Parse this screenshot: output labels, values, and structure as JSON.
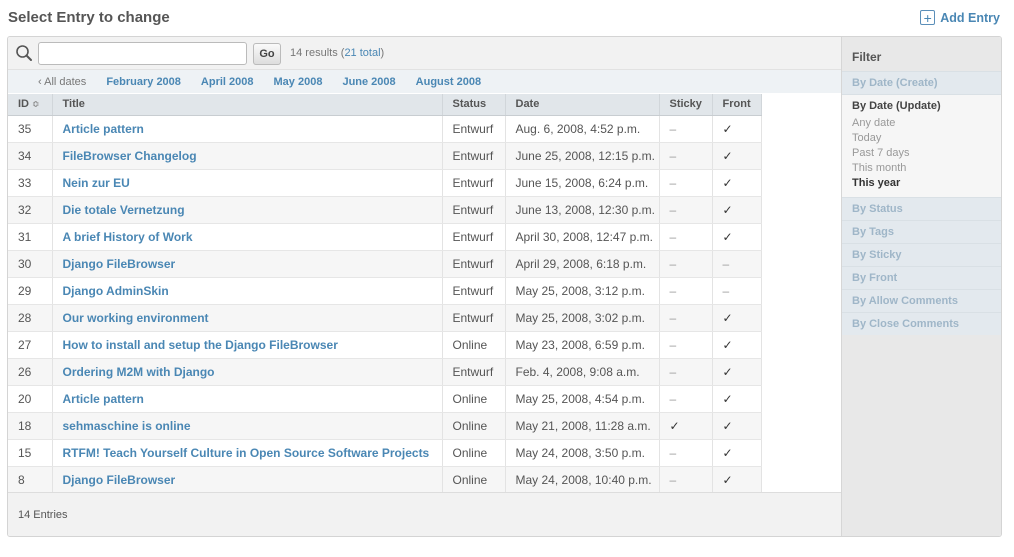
{
  "page": {
    "title": "Select Entry to change",
    "add_label": "Add Entry"
  },
  "search": {
    "value": "",
    "placeholder": "",
    "go_label": "Go",
    "results_count": "14 results",
    "results_total": "21 total"
  },
  "date_hierarchy": {
    "all_label": "‹ All dates",
    "dates": [
      "February 2008",
      "April 2008",
      "May 2008",
      "June 2008",
      "August 2008"
    ]
  },
  "table": {
    "headers": [
      "ID",
      "Title",
      "Status",
      "Date",
      "Sticky",
      "Front"
    ],
    "sort_indicator": "≎",
    "rows": [
      {
        "id": "35",
        "title": "Article pattern",
        "status": "Entwurf",
        "date": "Aug. 6, 2008, 4:52 p.m.",
        "sticky": "–",
        "front": "✓"
      },
      {
        "id": "34",
        "title": "FileBrowser Changelog",
        "status": "Entwurf",
        "date": "June 25, 2008, 12:15 p.m.",
        "sticky": "–",
        "front": "✓"
      },
      {
        "id": "33",
        "title": "Nein zur EU",
        "status": "Entwurf",
        "date": "June 15, 2008, 6:24 p.m.",
        "sticky": "–",
        "front": "✓"
      },
      {
        "id": "32",
        "title": "Die totale Vernetzung",
        "status": "Entwurf",
        "date": "June 13, 2008, 12:30 p.m.",
        "sticky": "–",
        "front": "✓"
      },
      {
        "id": "31",
        "title": "A brief History of Work",
        "status": "Entwurf",
        "date": "April 30, 2008, 12:47 p.m.",
        "sticky": "–",
        "front": "✓"
      },
      {
        "id": "30",
        "title": "Django FileBrowser",
        "status": "Entwurf",
        "date": "April 29, 2008, 6:18 p.m.",
        "sticky": "–",
        "front": "–"
      },
      {
        "id": "29",
        "title": "Django AdminSkin",
        "status": "Entwurf",
        "date": "May 25, 2008, 3:12 p.m.",
        "sticky": "–",
        "front": "–"
      },
      {
        "id": "28",
        "title": "Our working environment",
        "status": "Entwurf",
        "date": "May 25, 2008, 3:02 p.m.",
        "sticky": "–",
        "front": "✓"
      },
      {
        "id": "27",
        "title": "How to install and setup the Django FileBrowser",
        "status": "Online",
        "date": "May 23, 2008, 6:59 p.m.",
        "sticky": "–",
        "front": "✓"
      },
      {
        "id": "26",
        "title": "Ordering M2M with Django",
        "status": "Entwurf",
        "date": "Feb. 4, 2008, 9:08 a.m.",
        "sticky": "–",
        "front": "✓"
      },
      {
        "id": "20",
        "title": "Article pattern",
        "status": "Online",
        "date": "May 25, 2008, 4:54 p.m.",
        "sticky": "–",
        "front": "✓"
      },
      {
        "id": "18",
        "title": "sehmaschine is online",
        "status": "Online",
        "date": "May 21, 2008, 11:28 a.m.",
        "sticky": "✓",
        "front": "✓"
      },
      {
        "id": "15",
        "title": "RTFM! Teach Yourself Culture in Open Source Software Projects",
        "status": "Online",
        "date": "May 24, 2008, 3:50 p.m.",
        "sticky": "–",
        "front": "✓"
      },
      {
        "id": "8",
        "title": "Django FileBrowser",
        "status": "Online",
        "date": "May 24, 2008, 10:40 p.m.",
        "sticky": "–",
        "front": "✓"
      }
    ]
  },
  "footer": {
    "count_label": "14 Entries"
  },
  "filter": {
    "heading": "Filter",
    "groups_before": [
      "By Date (Create)"
    ],
    "open_group": "By Date (Update)",
    "options": [
      "Any date",
      "Today",
      "Past 7 days",
      "This month",
      "This year"
    ],
    "selected_option": "This year",
    "groups_after": [
      "By Status",
      "By Tags",
      "By Sticky",
      "By Front",
      "By Allow Comments",
      "By Close Comments"
    ]
  },
  "colors": {
    "link": "#4a87b4",
    "header_bg": "#e1e6ea",
    "sidebar_bg": "#e8e8e8"
  }
}
